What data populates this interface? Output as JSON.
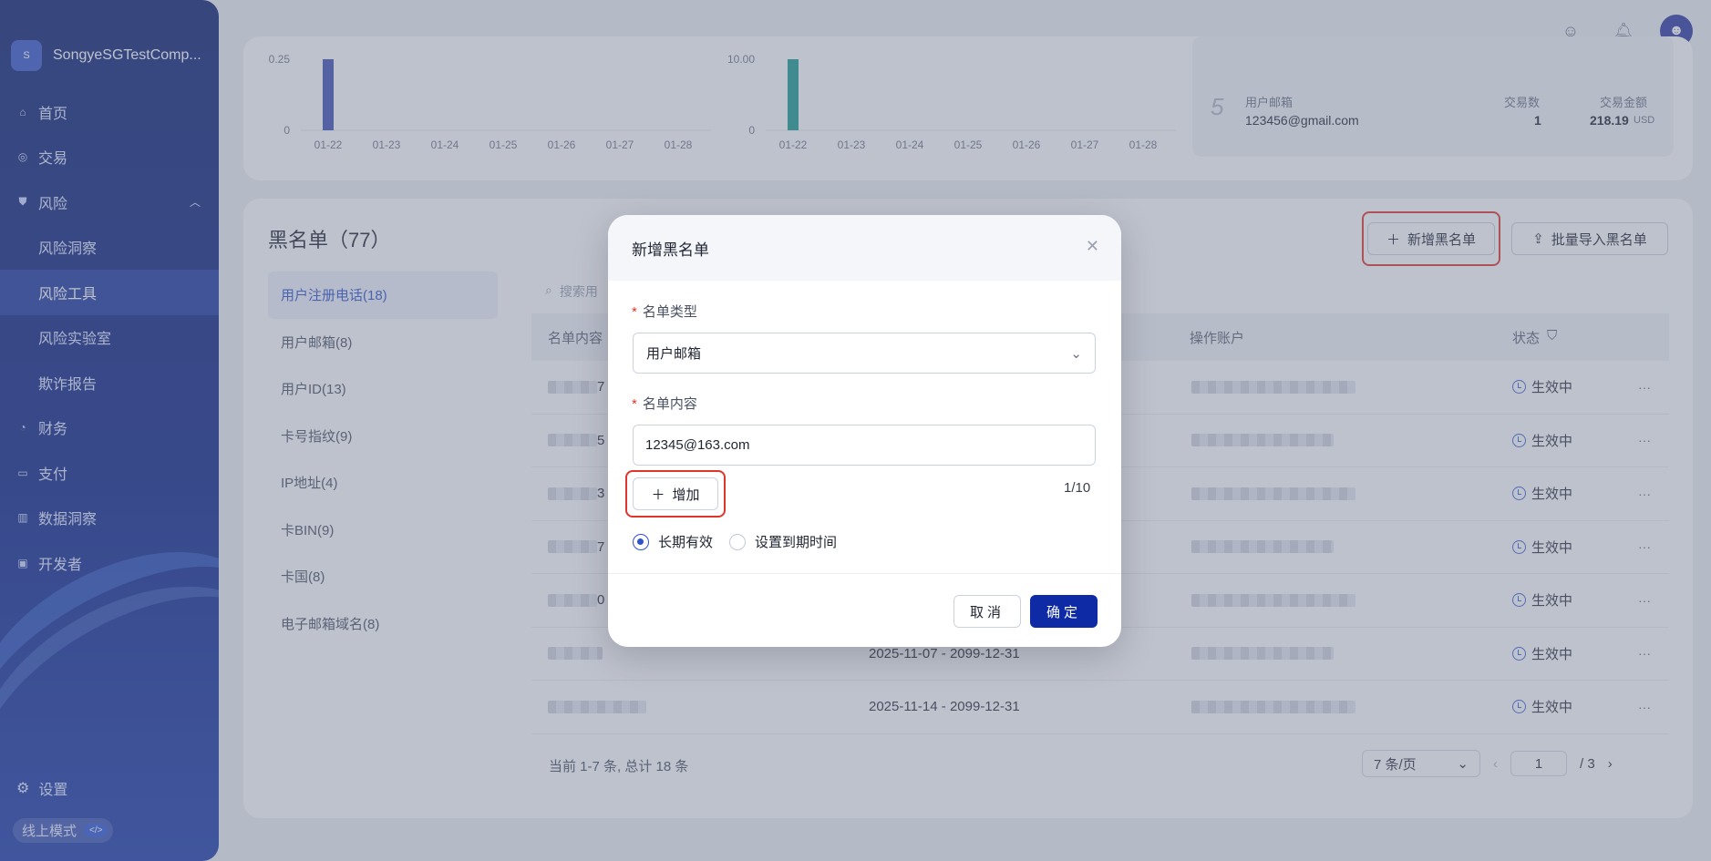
{
  "sidebar": {
    "logo_letter": "S",
    "company": "SongyeSGTestComp...",
    "items": [
      {
        "label": "首页",
        "icon": "home-icon",
        "glyph": "⌂"
      },
      {
        "label": "交易",
        "icon": "transaction-icon",
        "glyph": "◎"
      },
      {
        "label": "风险",
        "icon": "shield-icon",
        "glyph": "⛊",
        "expanded_glyph": "︿"
      },
      {
        "label": "风险洞察",
        "sub": true
      },
      {
        "label": "风险工具",
        "sub": true,
        "active": true
      },
      {
        "label": "风险实验室",
        "sub": true
      },
      {
        "label": "欺诈报告",
        "sub": true
      },
      {
        "label": "财务",
        "icon": "finance-icon",
        "glyph": "◔"
      },
      {
        "label": "支付",
        "icon": "wallet-icon",
        "glyph": "▭"
      },
      {
        "label": "数据洞察",
        "icon": "chart-icon",
        "glyph": "▥"
      },
      {
        "label": "开发者",
        "icon": "terminal-icon",
        "glyph": "▣"
      }
    ],
    "settings": "设置",
    "mode": "线上模式",
    "mode_tag": "</>"
  },
  "charts": {
    "x_labels": [
      "01-22",
      "01-23",
      "01-24",
      "01-25",
      "01-26",
      "01-27",
      "01-28"
    ],
    "left": {
      "y_top": "0.25",
      "y_zero": "0",
      "color": "#3f51b5"
    },
    "right": {
      "y_top": "10.00",
      "y_zero": "0",
      "color": "#1a9c8f"
    }
  },
  "stats": {
    "rank": "5",
    "label": "用户邮箱",
    "value": "123456@gmail.com",
    "count_label": "交易数",
    "count": "1",
    "amount_label": "交易金额",
    "amount": "218.19",
    "currency": "USD"
  },
  "blacklist": {
    "title": "黑名单（77）",
    "new_button": "新增黑名单",
    "import_button": "批量导入黑名单",
    "search_placeholder": "搜索用",
    "categories": [
      "用户注册电话(18)",
      "用户邮箱(8)",
      "用户ID(13)",
      "卡号指纹(9)",
      "IP地址(4)",
      "卡BIN(9)",
      "卡国(8)",
      "电子邮箱域名(8)"
    ],
    "columns": {
      "content": "名单内容",
      "operator": "操作账户",
      "status": "状态"
    },
    "rows": [
      {
        "suffix": "7",
        "period": "",
        "status": "生效中"
      },
      {
        "suffix": "5",
        "period": "",
        "status": "生效中"
      },
      {
        "suffix": "3",
        "period": "",
        "status": "生效中"
      },
      {
        "suffix": "7",
        "period": "",
        "status": "生效中"
      },
      {
        "suffix": "0",
        "period": "",
        "status": "生效中"
      },
      {
        "suffix": "",
        "period": "2025-11-07 - 2099-12-31",
        "status": "生效中"
      },
      {
        "suffix": "",
        "period": "2025-11-14 - 2099-12-31",
        "status": "生效中"
      }
    ],
    "footer": "当前 1-7 条, 总计 18 条",
    "page_size": "7 条/页",
    "current_page": "1",
    "total_pages": "/ 3"
  },
  "modal": {
    "title": "新增黑名单",
    "type_label": "名单类型",
    "type_value": "用户邮箱",
    "content_label": "名单内容",
    "content_value": "12345@163.com",
    "add_button": "增加",
    "counter": "1/10",
    "radio_permanent": "长期有效",
    "radio_expiry": "设置到期时间",
    "cancel": "取消",
    "confirm": "确定"
  },
  "colors": {
    "accent": "#0f2aa5",
    "highlight": "#e0352b",
    "status_icon": "#3a63d6"
  }
}
